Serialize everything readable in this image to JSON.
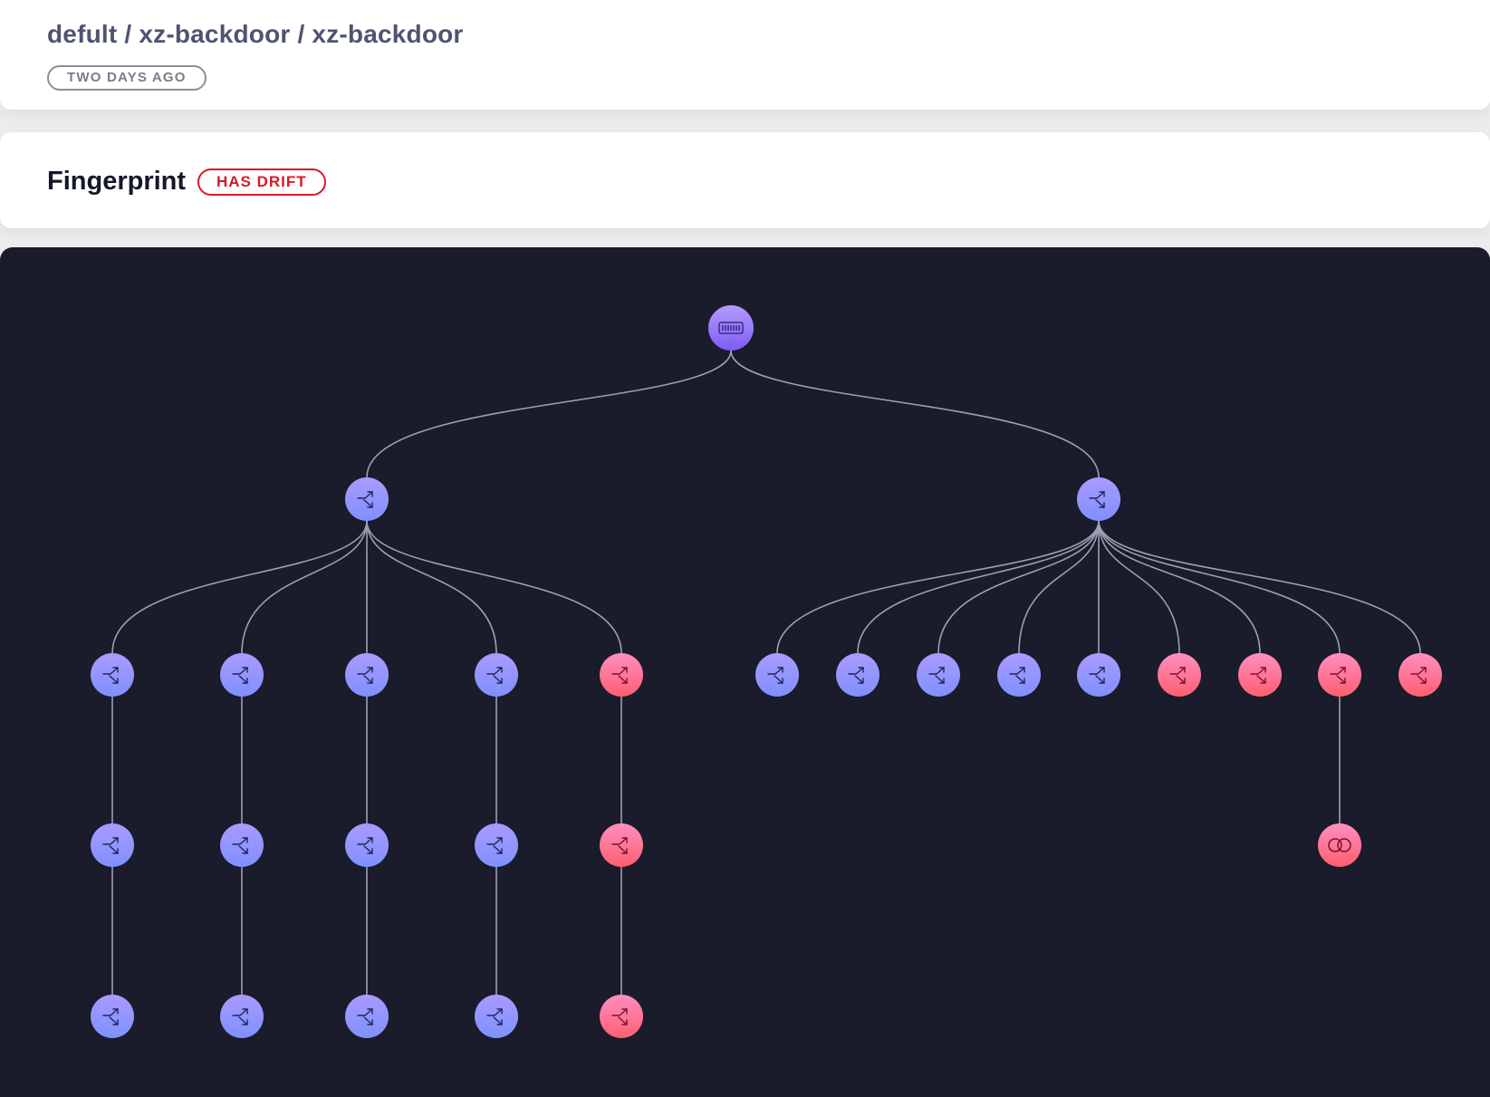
{
  "header": {
    "breadcrumb": "defult / xz-backdoor / xz-backdoor",
    "time_badge": "TWO DAYS AGO"
  },
  "fingerprint": {
    "title": "Fingerprint",
    "status_badge": "HAS DRIFT"
  },
  "colors": {
    "panel_bg": "#1a1b2b",
    "edge": "#9ca0b2",
    "root_node": "#8f6cf5",
    "normal_node": "#8a93ff",
    "drift_node": "#ff6b7f",
    "drift_badge": "#d71a27"
  },
  "graph": {
    "root": {
      "icon": "container-icon",
      "status": "normal",
      "children": [
        {
          "icon": "process-icon",
          "status": "normal",
          "children": [
            {
              "icon": "process-icon",
              "status": "normal",
              "children": [
                {
                  "icon": "process-icon",
                  "status": "normal",
                  "children": [
                    {
                      "icon": "process-icon",
                      "status": "normal",
                      "children": []
                    }
                  ]
                }
              ]
            },
            {
              "icon": "process-icon",
              "status": "normal",
              "children": [
                {
                  "icon": "process-icon",
                  "status": "normal",
                  "children": [
                    {
                      "icon": "process-icon",
                      "status": "normal",
                      "children": []
                    }
                  ]
                }
              ]
            },
            {
              "icon": "process-icon",
              "status": "normal",
              "children": [
                {
                  "icon": "process-icon",
                  "status": "normal",
                  "children": [
                    {
                      "icon": "process-icon",
                      "status": "normal",
                      "children": []
                    }
                  ]
                }
              ]
            },
            {
              "icon": "process-icon",
              "status": "normal",
              "children": [
                {
                  "icon": "process-icon",
                  "status": "normal",
                  "children": [
                    {
                      "icon": "process-icon",
                      "status": "normal",
                      "children": []
                    }
                  ]
                }
              ]
            },
            {
              "icon": "process-icon",
              "status": "drift",
              "children": [
                {
                  "icon": "process-icon",
                  "status": "drift",
                  "children": [
                    {
                      "icon": "process-icon",
                      "status": "drift",
                      "children": []
                    }
                  ]
                }
              ]
            }
          ]
        },
        {
          "icon": "process-icon",
          "status": "normal",
          "children": [
            {
              "icon": "process-icon",
              "status": "normal",
              "children": []
            },
            {
              "icon": "process-icon",
              "status": "normal",
              "children": []
            },
            {
              "icon": "process-icon",
              "status": "normal",
              "children": []
            },
            {
              "icon": "process-icon",
              "status": "normal",
              "children": []
            },
            {
              "icon": "process-icon",
              "status": "normal",
              "children": []
            },
            {
              "icon": "process-icon",
              "status": "drift",
              "children": []
            },
            {
              "icon": "process-icon",
              "status": "drift",
              "children": []
            },
            {
              "icon": "process-icon",
              "status": "drift",
              "children": [
                {
                  "icon": "network-icon",
                  "status": "drift",
                  "children": []
                }
              ]
            },
            {
              "icon": "process-icon",
              "status": "drift",
              "children": []
            }
          ]
        }
      ]
    }
  }
}
